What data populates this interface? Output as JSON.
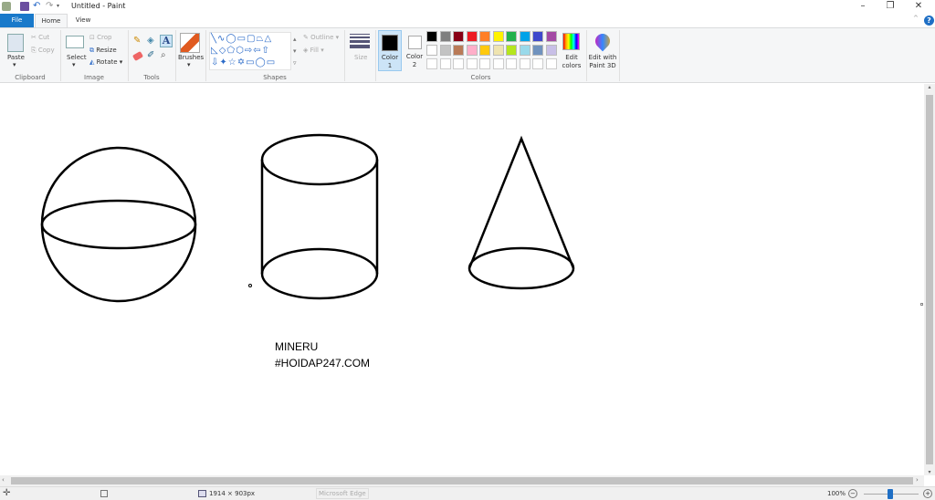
{
  "window": {
    "title": "Untitled - Paint",
    "minimize": "–",
    "maximize": "❐",
    "close": "✕",
    "help": "?"
  },
  "tabs": [
    {
      "label": "File"
    },
    {
      "label": "Home"
    },
    {
      "label": "View"
    }
  ],
  "ribbon": {
    "clipboard": {
      "group": "Clipboard",
      "paste": "Paste",
      "cut": "Cut",
      "copy": "Copy"
    },
    "image": {
      "group": "Image",
      "select": "Select",
      "crop": "Crop",
      "resize": "Resize",
      "rotate": "Rotate"
    },
    "tools": {
      "group": "Tools"
    },
    "brushes": {
      "label": "Brushes"
    },
    "shapes": {
      "group": "Shapes",
      "outline": "Outline",
      "fill": "Fill"
    },
    "size": {
      "label": "Size"
    },
    "colors": {
      "group": "Colors",
      "color1": "Color 1",
      "color2": "Color 2",
      "edit_colors": "Edit colors",
      "paint3d": "Edit with Paint 3D",
      "color1_value": "#000000",
      "color2_value": "#ffffff",
      "palette_row1": [
        "#000000",
        "#7f7f7f",
        "#880015",
        "#ed1c24",
        "#ff7f27",
        "#fff200",
        "#22b14c",
        "#00a2e8",
        "#3f48cc",
        "#a349a4"
      ],
      "palette_row2": [
        "#ffffff",
        "#c3c3c3",
        "#b97a57",
        "#ffaec9",
        "#ffc90e",
        "#efe4b0",
        "#b5e61d",
        "#99d9ea",
        "#7092be",
        "#c8bfe7"
      ]
    }
  },
  "canvas": {
    "text_line1": "MINERU",
    "text_line2": "#HOIDAP247.COM"
  },
  "status": {
    "dimensions": "1914 × 903px",
    "taskbar_hint": "Microsoft Edge",
    "zoom": "100%",
    "zoom_level_percent": 100
  }
}
